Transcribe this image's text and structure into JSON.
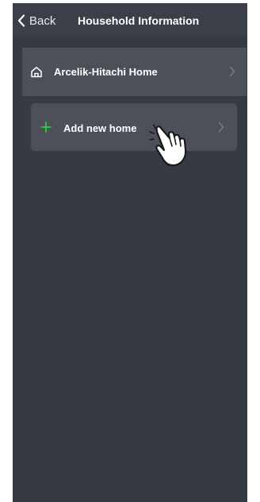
{
  "header": {
    "back_label": "Back",
    "title": "Household Information"
  },
  "homes": [
    {
      "name": "Arcelik-Hitachi Home",
      "icon": "home-icon"
    }
  ],
  "add_home": {
    "label": "Add new home",
    "icon": "plus-icon",
    "accent": "#2ecc40"
  },
  "colors": {
    "background": "#363a42",
    "row": "#4b5059",
    "text": "#ffffff"
  }
}
